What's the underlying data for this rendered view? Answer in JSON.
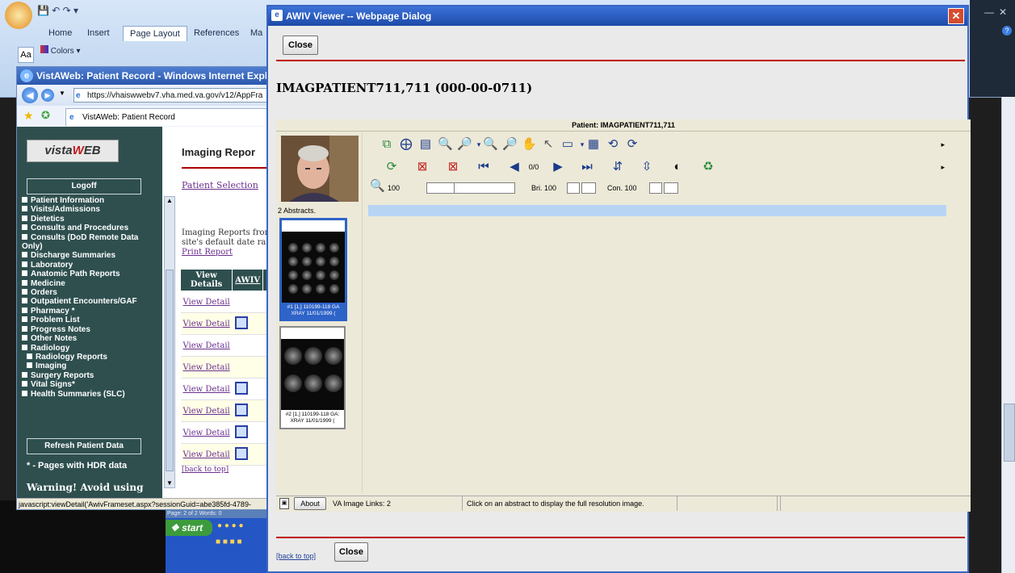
{
  "word": {
    "tabs": [
      "Home",
      "Insert",
      "Page Layout",
      "References",
      "Ma"
    ],
    "active_tab": "Page Layout",
    "colors_label": "Colors",
    "status": "Page: 2 of 2   Words: 0"
  },
  "taskbar": {
    "start": "start"
  },
  "ie": {
    "title": "VistAWeb: Patient Record - Windows Internet Explorer",
    "url": "https://vhaiswwebv7.vha.med.va.gov/v12/AppFra",
    "tab": "VistAWeb: Patient Record",
    "status_text": "javascript:viewDetail('AwivFrameset.aspx?sessionGuid=abe385fd-4789-"
  },
  "vistaweb": {
    "logoff": "Logoff",
    "nav": [
      {
        "label": "Patient Information",
        "sub": false
      },
      {
        "label": "Visits/Admissions",
        "sub": false
      },
      {
        "label": "Dietetics",
        "sub": false
      },
      {
        "label": "Consults and Procedures",
        "sub": false
      },
      {
        "label": "Consults (DoD Remote Data",
        "sub": false
      },
      {
        "label": "Only)",
        "sub": false,
        "nosq": true
      },
      {
        "label": "Discharge Summaries",
        "sub": false
      },
      {
        "label": "Laboratory",
        "sub": false
      },
      {
        "label": "Anatomic Path Reports",
        "sub": false
      },
      {
        "label": "Medicine",
        "sub": false
      },
      {
        "label": "Orders",
        "sub": false
      },
      {
        "label": "Outpatient Encounters/GAF",
        "sub": false
      },
      {
        "label": "Pharmacy *",
        "sub": false
      },
      {
        "label": "Problem List",
        "sub": false
      },
      {
        "label": "Progress Notes",
        "sub": false
      },
      {
        "label": "Other Notes",
        "sub": false
      },
      {
        "label": "Radiology",
        "sub": false
      },
      {
        "label": "Radiology Reports",
        "sub": true
      },
      {
        "label": "Imaging",
        "sub": true
      },
      {
        "label": "Surgery Reports",
        "sub": false
      },
      {
        "label": "Vital Signs*",
        "sub": false
      },
      {
        "label": "Health Summaries (SLC)",
        "sub": false
      }
    ],
    "refresh": "Refresh Patient Data",
    "hdr_note": "* - Pages with HDR data",
    "warning": "Warning! Avoid using",
    "page_title": "Imaging Repor",
    "patient_selection": "Patient Selection",
    "imaging_text_1": "Imaging Reports from",
    "imaging_text_2": "site's default date ran",
    "print_report": "Print Report",
    "col_view": "View Details",
    "col_awiv": "AWIV",
    "view_detail": "View Detail",
    "back_to_top": "[back to top]"
  },
  "dialog": {
    "title": "AWIV Viewer -- Webpage Dialog",
    "close": "Close",
    "patient_heading": "IMAGPATIENT711,711 (000-00-0711)",
    "viewer_patient": "Patient: IMAGPATIENT711,711",
    "abstract_count": "2 Abstracts.",
    "abstracts": [
      {
        "line1": "#1 [1,] 110199-118  GA",
        "line2": "XRAY 11/01/1999 ("
      },
      {
        "line1": "#2 [1,] 110199-118  GA:",
        "line2": "XRAY 11/01/1999 ("
      }
    ],
    "zoom_value": "100",
    "bri_label": "Bri. 100",
    "con_label": "Con. 100",
    "image_count": "0/0",
    "status": {
      "about": "About",
      "links": "VA Image Links: 2",
      "hint": "Click on an abstract to display the full resolution image."
    },
    "back_to_top": "[back to top]"
  },
  "colors": {
    "accent_red": "#c00000",
    "dialog_blue": "#2e63c8",
    "vistaweb_green": "#2f4f4f"
  }
}
